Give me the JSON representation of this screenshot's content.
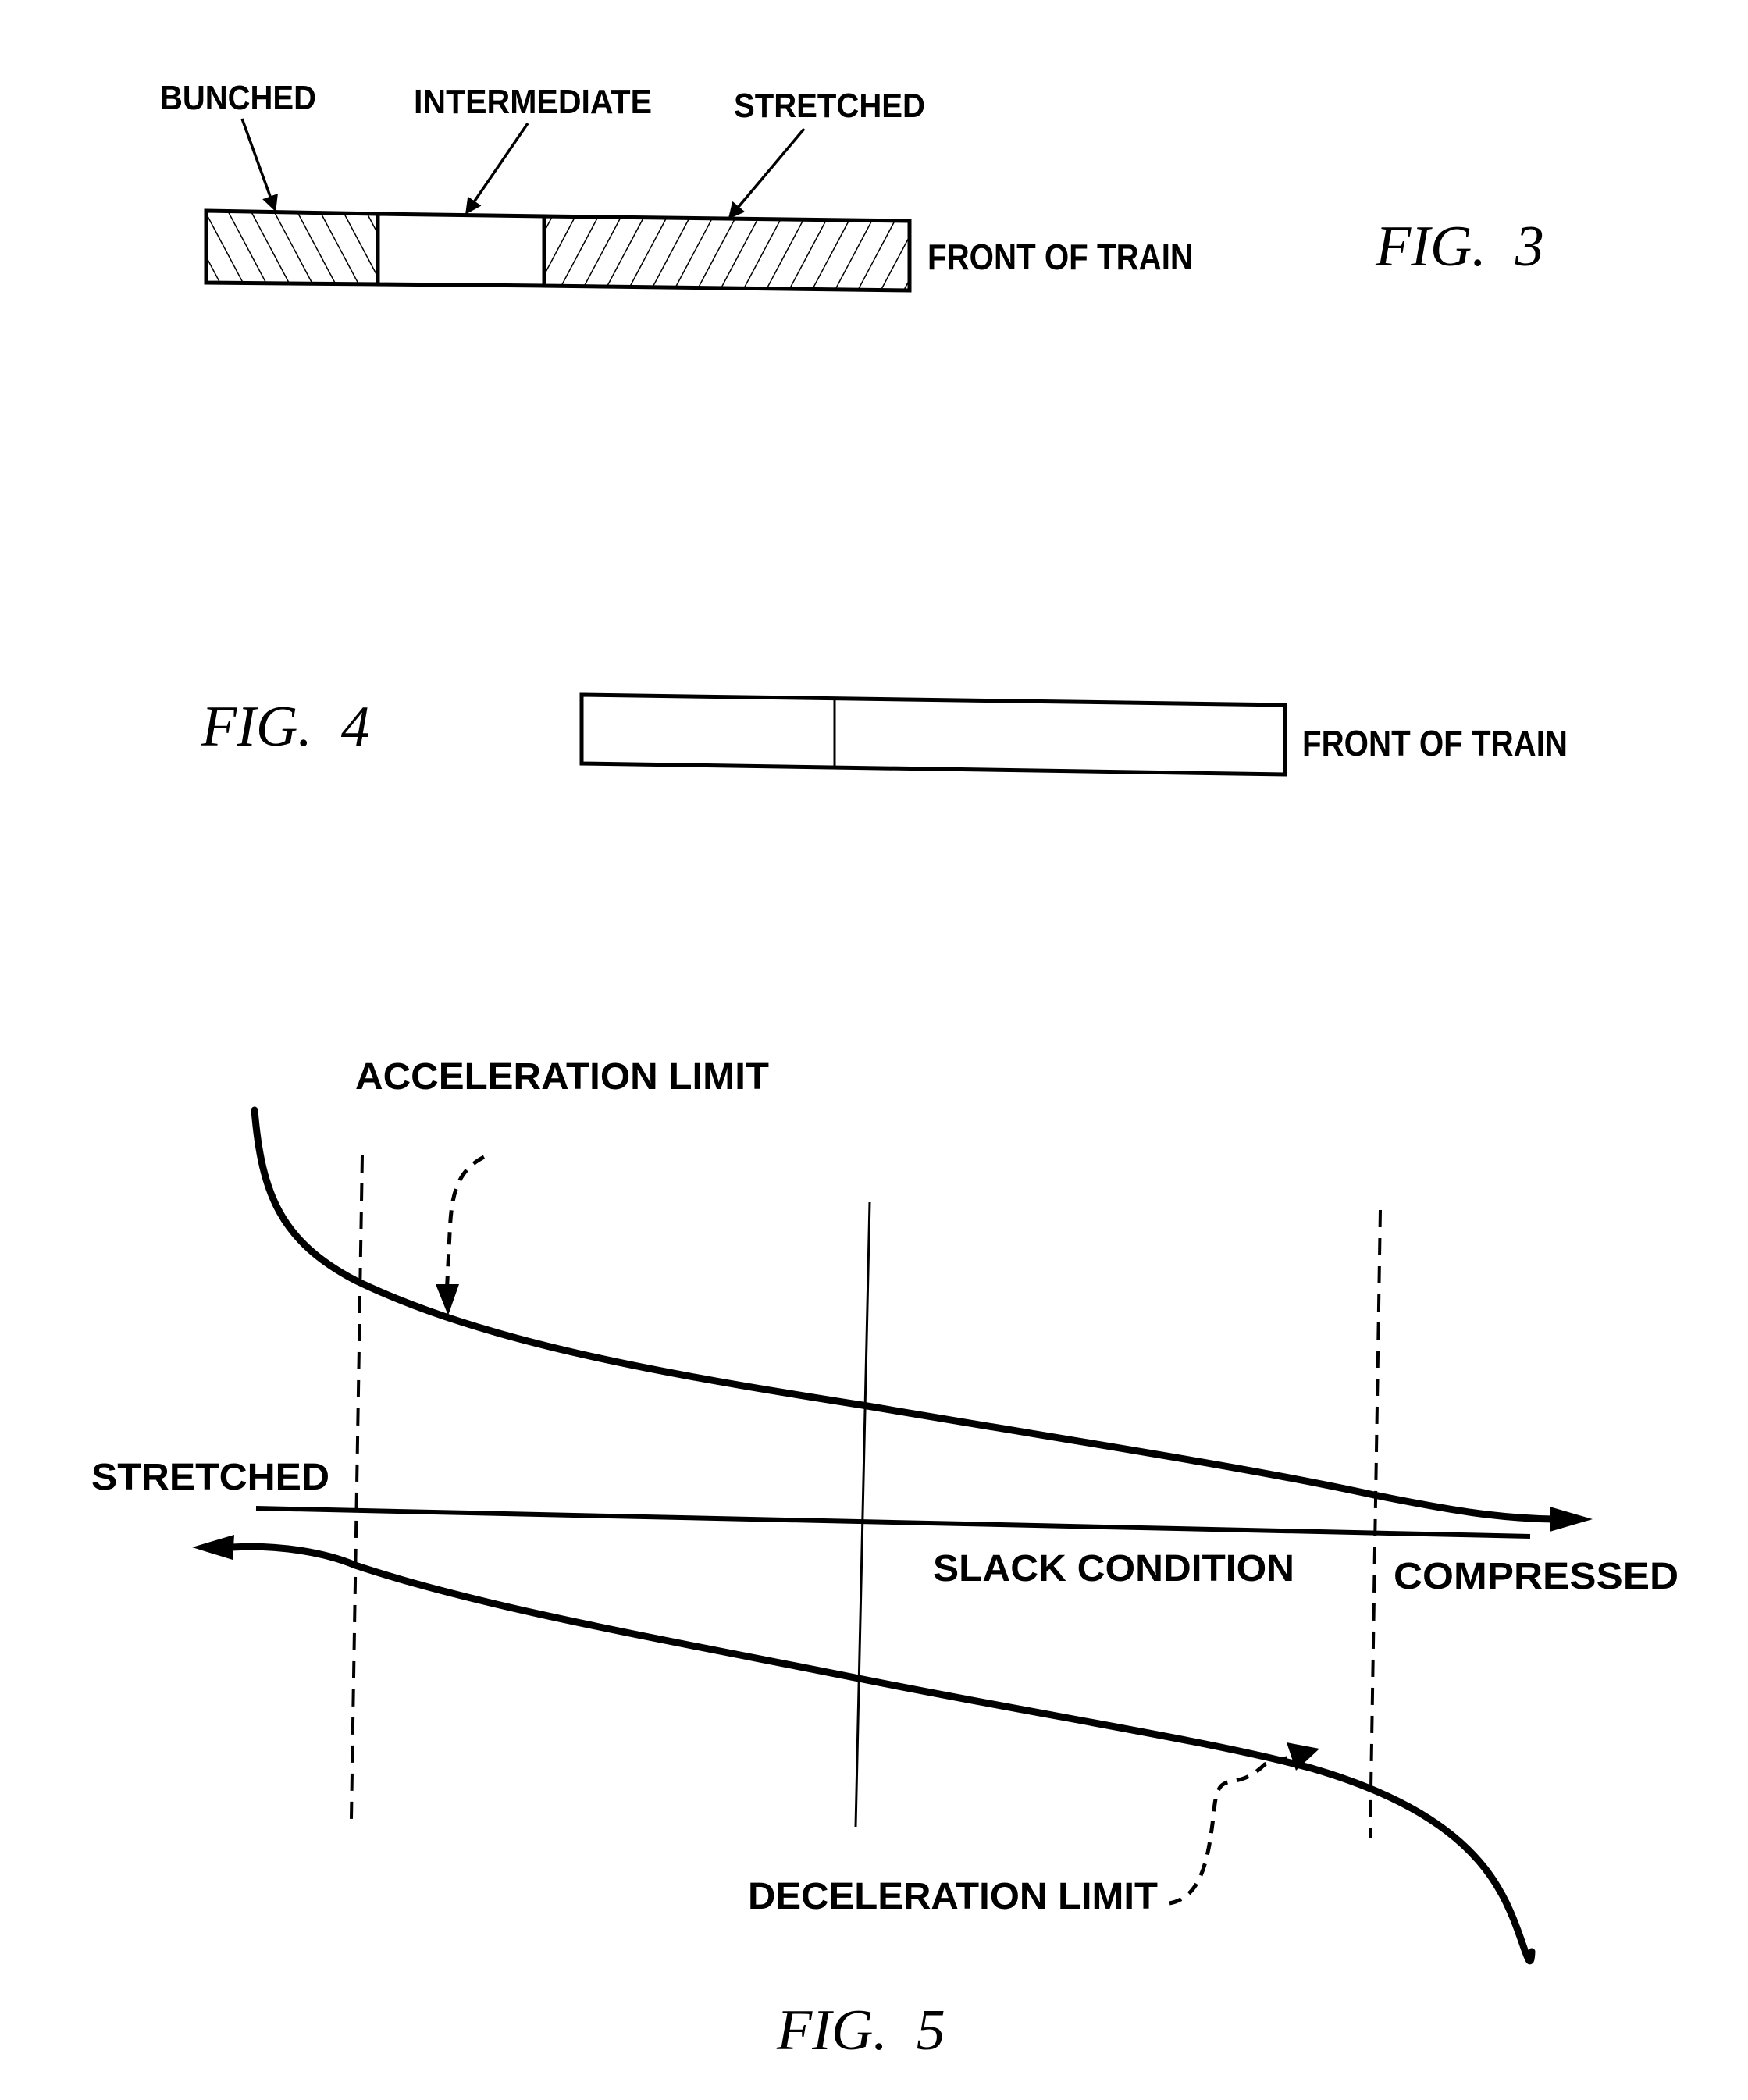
{
  "fig3": {
    "caption": "FIG.  3",
    "segments": [
      {
        "label": "BUNCHED",
        "pattern": "hatch-backslash"
      },
      {
        "label": "INTERMEDIATE",
        "pattern": "none"
      },
      {
        "label": "STRETCHED",
        "pattern": "hatch-slash"
      }
    ],
    "front_label": "FRONT OF TRAIN"
  },
  "fig4": {
    "caption": "FIG.  4",
    "front_label": "FRONT OF TRAIN"
  },
  "fig5": {
    "caption": "FIG.  5",
    "labels": {
      "acceleration_limit": "ACCELERATION LIMIT",
      "stretched": "STRETCHED",
      "slack_condition": "SLACK CONDITION",
      "compressed": "COMPRESSED",
      "deceleration_limit": "DECELERATION LIMIT"
    }
  }
}
